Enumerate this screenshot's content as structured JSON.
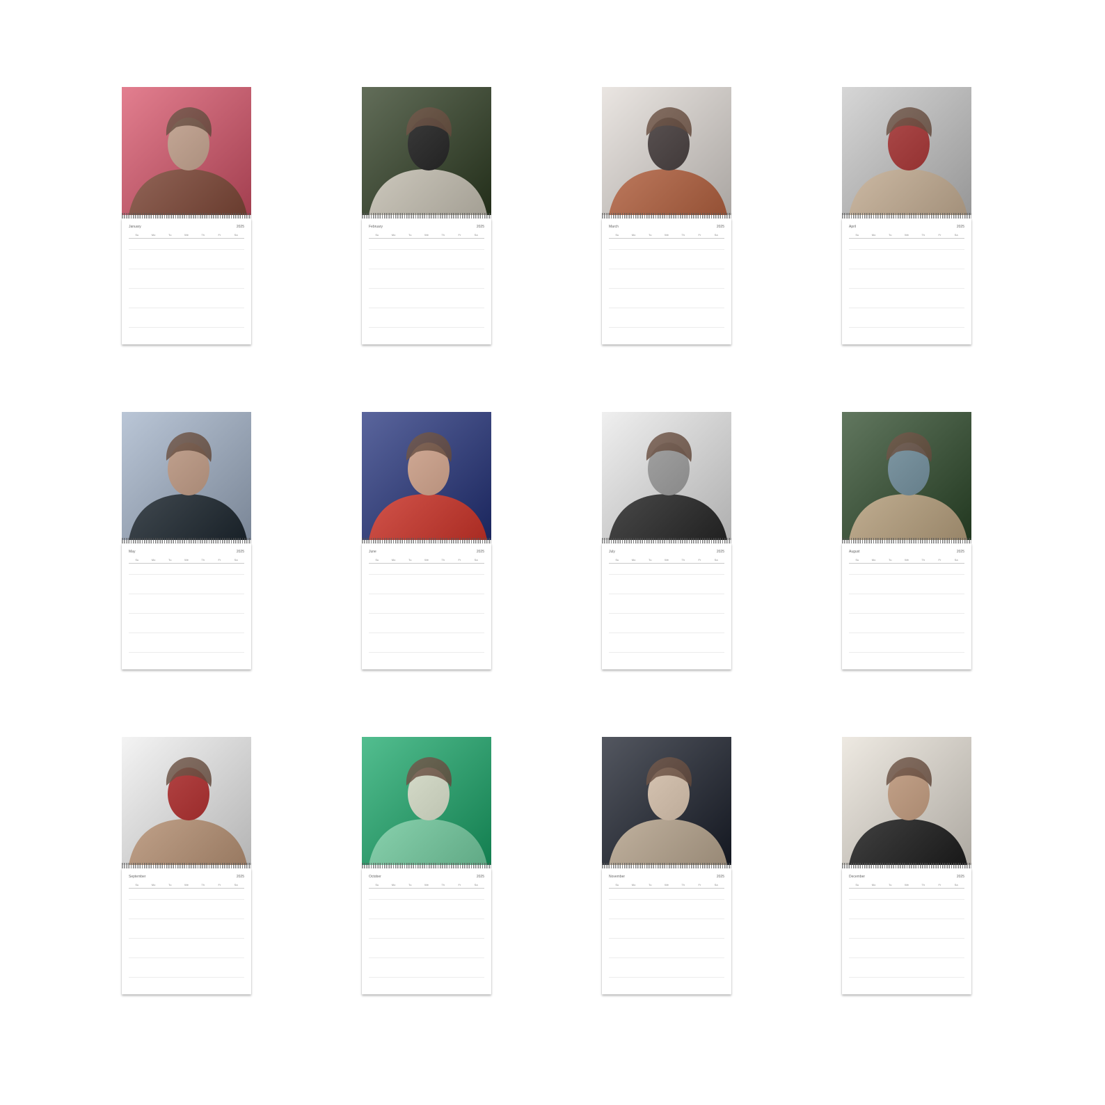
{
  "year": "2025",
  "weekdays": [
    "Su",
    "Mo",
    "Tu",
    "We",
    "Th",
    "Fr",
    "Sa"
  ],
  "calendars": [
    {
      "month": "January",
      "photo_colors": [
        "#d9546a",
        "#8a4e3c",
        "#c9a38c"
      ]
    },
    {
      "month": "February",
      "photo_colors": [
        "#2e3d22",
        "#d9d3c4",
        "#111111"
      ]
    },
    {
      "month": "March",
      "photo_colors": [
        "#e3ddd8",
        "#c46a45",
        "#3a3030"
      ]
    },
    {
      "month": "April",
      "photo_colors": [
        "#c9c9c9",
        "#d8bfa2",
        "#a82525"
      ]
    },
    {
      "month": "May",
      "photo_colors": [
        "#a3b3c9",
        "#1f2a33",
        "#c49a81"
      ]
    },
    {
      "month": "June",
      "photo_colors": [
        "#23327c",
        "#e0382c",
        "#d9a58a"
      ]
    },
    {
      "month": "July",
      "photo_colors": [
        "#eaeaea",
        "#2a2a2a",
        "#9a9a9a"
      ]
    },
    {
      "month": "August",
      "photo_colors": [
        "#2d4a2a",
        "#c9b08a",
        "#6b8c9c"
      ]
    },
    {
      "month": "September",
      "photo_colors": [
        "#f0f0f0",
        "#c9a080",
        "#b11d1d"
      ]
    },
    {
      "month": "October",
      "photo_colors": [
        "#19a86a",
        "#7fe0b0",
        "#e0e8d0"
      ]
    },
    {
      "month": "November",
      "photo_colors": [
        "#1a1f2b",
        "#c9b59c",
        "#e0c8b0"
      ]
    },
    {
      "month": "December",
      "photo_colors": [
        "#e8e2d8",
        "#1f1f1f",
        "#c79b7a"
      ]
    }
  ]
}
